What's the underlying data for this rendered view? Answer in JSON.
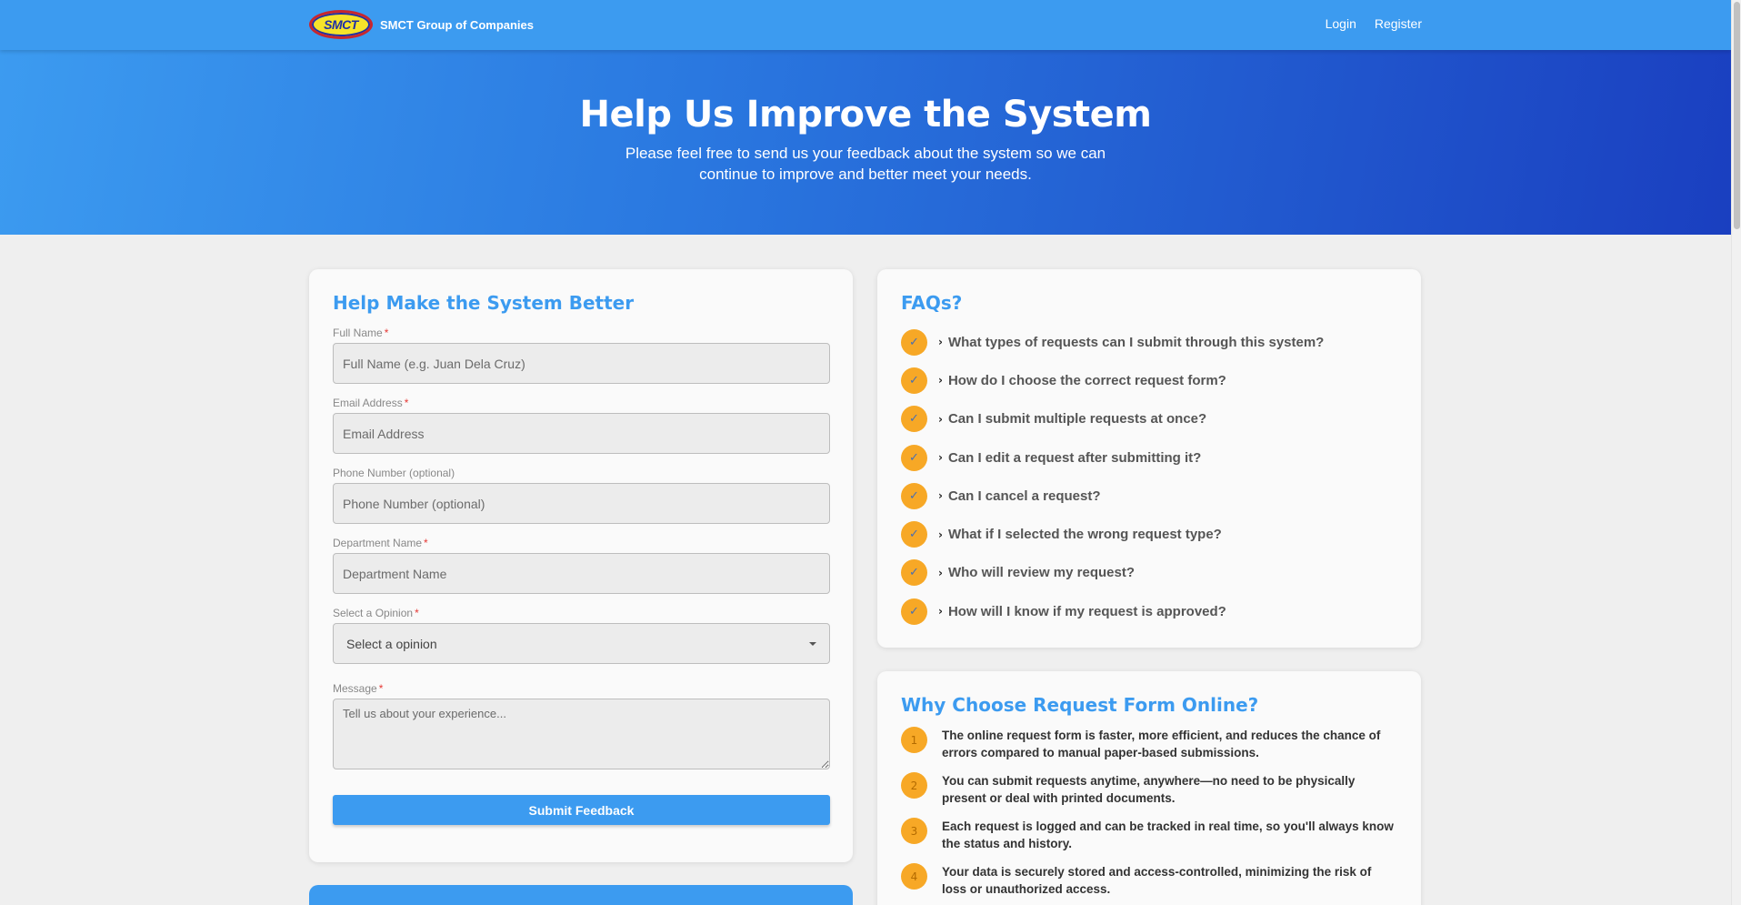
{
  "nav": {
    "logo_text": "SMCT",
    "brand": "SMCT Group of Companies",
    "login": "Login",
    "register": "Register"
  },
  "hero": {
    "title": "Help Us Improve the System",
    "subtitle": "Please feel free to send us your feedback about the system so we can continue to improve and better meet your needs."
  },
  "form": {
    "title": "Help Make the System Better",
    "full_name_label": "Full Name",
    "full_name_placeholder": "Full Name (e.g. Juan Dela Cruz)",
    "email_label": "Email Address",
    "email_placeholder": "Email Address",
    "phone_label": "Phone Number (optional)",
    "phone_placeholder": "Phone Number (optional)",
    "department_label": "Department Name",
    "department_placeholder": "Department Name",
    "opinion_label": "Select a Opinion",
    "opinion_selected": "Select a opinion",
    "message_label": "Message",
    "message_placeholder": "Tell us about your experience...",
    "required_mark": "*",
    "submit_label": "Submit Feedback"
  },
  "faq": {
    "title": "FAQs?",
    "check_glyph": "✓",
    "chevron_glyph": "›",
    "items": [
      "What types of requests can I submit through this system?",
      "How do I choose the correct request form?",
      "Can I submit multiple requests at once?",
      "Can I edit a request after submitting it?",
      "Can I cancel a request?",
      "What if I selected the wrong request type?",
      "Who will review my request?",
      "How will I know if my request is approved?"
    ]
  },
  "why": {
    "title": "Why Choose Request Form Online?",
    "items": [
      {
        "num": "1",
        "text": "The online request form is faster, more efficient, and reduces the chance of errors compared to manual paper-based submissions."
      },
      {
        "num": "2",
        "text": "You can submit requests anytime, anywhere—no need to be physically present or deal with printed documents."
      },
      {
        "num": "3",
        "text": "Each request is logged and can be tracked in real time, so you'll always know the status and history."
      },
      {
        "num": "4",
        "text": "Your data is securely stored and access-controlled, minimizing the risk of loss or unauthorized access."
      }
    ]
  },
  "colors": {
    "primary": "#3c9bf0",
    "hero_end": "#1a3fc0",
    "badge": "#f7a826",
    "required": "#e53935"
  }
}
